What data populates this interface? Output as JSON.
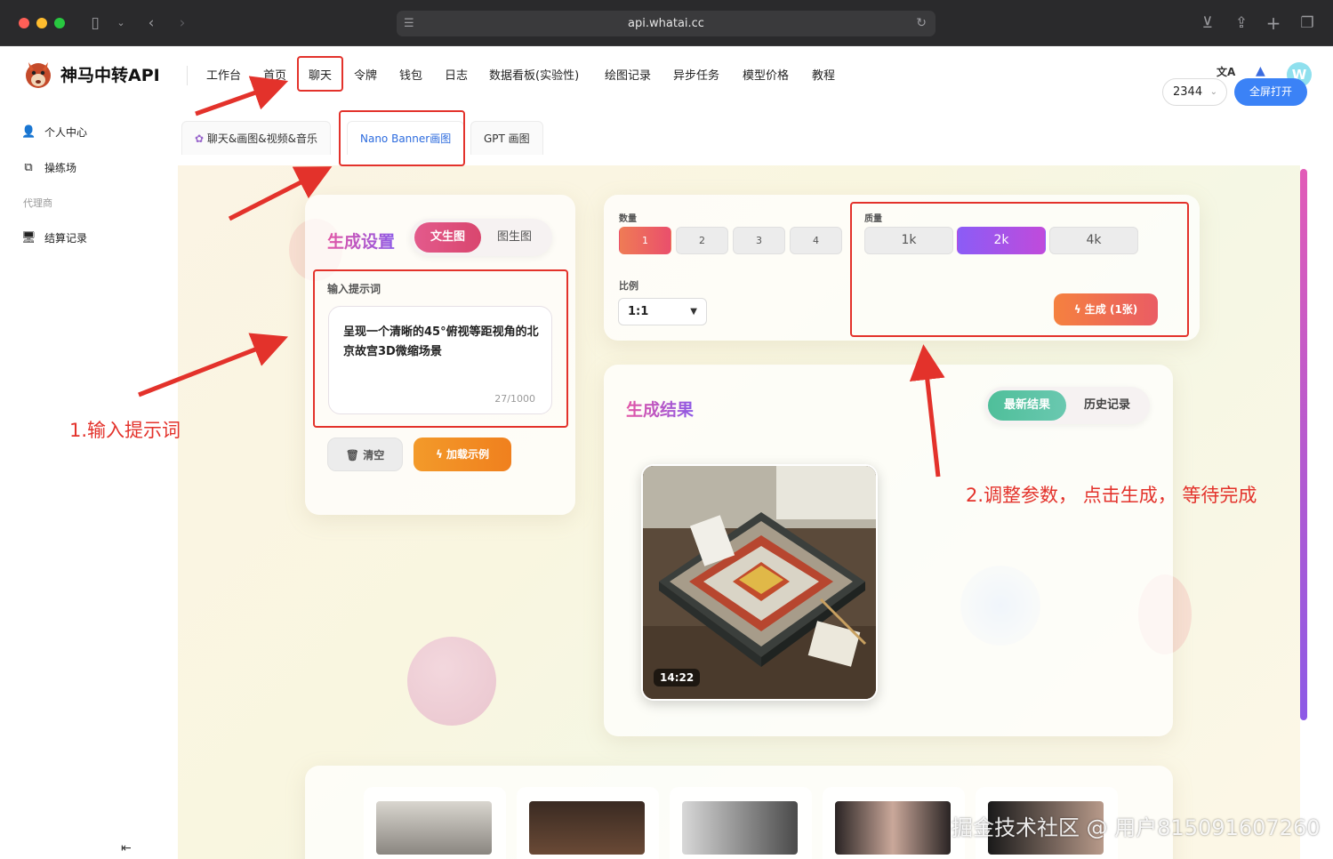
{
  "browser": {
    "url": "api.whatai.cc",
    "colors": {
      "close": "#ff5f57",
      "minimize": "#febc2e",
      "maximize": "#28c840"
    }
  },
  "brand": {
    "name": "神马中转API"
  },
  "nav": {
    "items": [
      "工作台",
      "首页",
      "聊天",
      "令牌",
      "钱包",
      "日志",
      "数据看板(实验性)",
      "绘图记录",
      "异步任务",
      "模型价格",
      "教程"
    ],
    "avatar_letter": "W",
    "translate_icon": "文A"
  },
  "sidebar": {
    "items": [
      {
        "icon": "user-icon",
        "label": "个人中心"
      },
      {
        "icon": "playground-icon",
        "label": "操练场"
      }
    ],
    "section_label": "代理商",
    "items2": [
      {
        "icon": "monitor-icon",
        "label": "结算记录"
      }
    ]
  },
  "tabs": {
    "items": [
      "聊天&画图&视频&音乐",
      "Nano Banner画图",
      "GPT 画图"
    ],
    "active": 1,
    "select_value": "2344",
    "fullscreen_label": "全屏打开"
  },
  "settings": {
    "title": "生成设置",
    "mode_tabs": [
      "文生图",
      "图生图"
    ],
    "prompt_label": "输入提示词",
    "prompt_value": "呈现一个清晰的45°俯视等距视角的北京故宫3D微缩场景",
    "counter": "27/1000",
    "clear_label": "清空",
    "example_label": "加载示例"
  },
  "params": {
    "count_label": "数量",
    "counts": [
      "1",
      "2",
      "3",
      "4"
    ],
    "count_selected": "1",
    "ratio_label": "比例",
    "ratio_value": "1:1",
    "quality_label": "质量",
    "qualities": [
      "1k",
      "2k",
      "4k"
    ],
    "quality_selected": "2k",
    "generate_label": "生成 (1张)"
  },
  "results": {
    "title": "生成结果",
    "tabs": [
      "最新结果",
      "历史记录"
    ],
    "image_time": "14:22"
  },
  "annotations": {
    "step1": "1.输入提示词",
    "step2": "2.调整参数，  点击生成，  等待完成"
  },
  "watermark": "掘金技术社区 @ 用户815091607260",
  "accent": {
    "primary": "#3b82f6",
    "annotation": "#e3322b",
    "title_gradient": [
      "#e255a6",
      "#8e5ae6"
    ]
  }
}
